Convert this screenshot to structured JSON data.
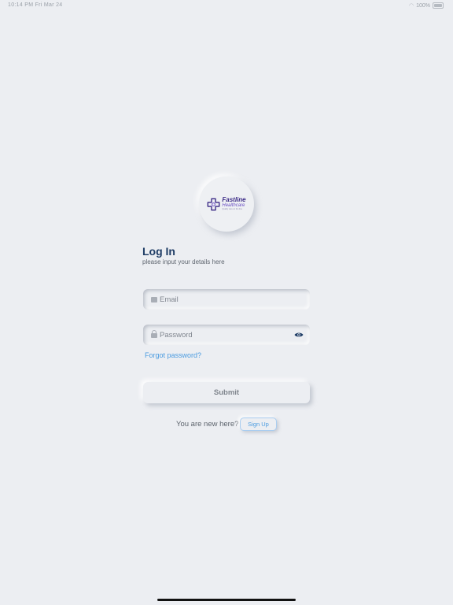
{
  "status_bar": {
    "time_date": "10:14 PM  Fri Mar 24",
    "battery": "100%"
  },
  "logo": {
    "name": "Fastline",
    "sub": "Healthcare",
    "tagline": "Quality care on the line",
    "icon": "medical-cross-icon",
    "brand_color": "#3b2a86",
    "accent_color": "#6b4fc4"
  },
  "login": {
    "title": "Log In",
    "subtitle": "please input your details here"
  },
  "email_field": {
    "placeholder": "Email",
    "value": "",
    "icon": "mail-icon"
  },
  "password_field": {
    "placeholder": "Password",
    "value": "",
    "icon": "lock-icon",
    "toggle_icon": "eye-icon"
  },
  "forgot_password": "Forgot password?",
  "submit_label": "Submit",
  "signup_prompt": "You are new here?",
  "signup_label": "Sign Up",
  "colors": {
    "background": "#eceef2",
    "title": "#1f3d66",
    "link": "#4a9be0",
    "eye_icon": "#1f3d66"
  }
}
